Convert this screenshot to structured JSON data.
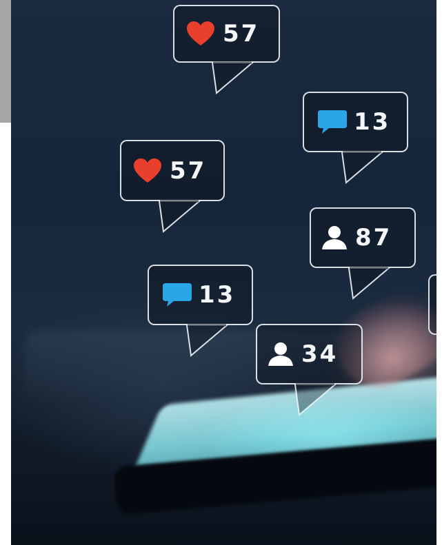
{
  "notifications": [
    {
      "type": "like",
      "icon": "heart-icon",
      "value": "57"
    },
    {
      "type": "comment",
      "icon": "comment-icon",
      "value": "13"
    },
    {
      "type": "like",
      "icon": "heart-icon",
      "value": "57"
    },
    {
      "type": "follower",
      "icon": "user-icon",
      "value": "87"
    },
    {
      "type": "comment",
      "icon": "comment-icon",
      "value": "13"
    },
    {
      "type": "follower",
      "icon": "user-icon",
      "value": "34"
    }
  ],
  "colors": {
    "heart": "#e8402c",
    "comment": "#2aa6e6",
    "user": "#ffffff",
    "text": "#f4f6f8"
  }
}
